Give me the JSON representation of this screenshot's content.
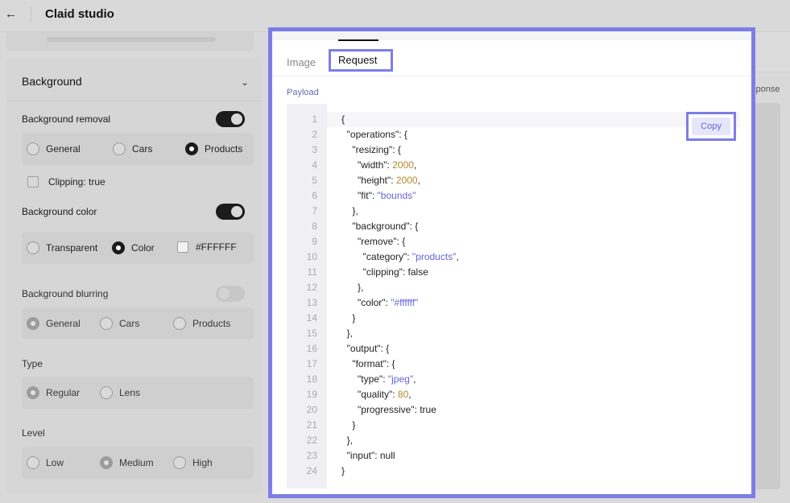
{
  "header": {
    "title": "Claid studio",
    "back_icon": "arrow-left-icon"
  },
  "left_panel": {
    "section_title": "Background",
    "background_removal": {
      "label": "Background removal",
      "toggle_on": true,
      "options": [
        "General",
        "Cars",
        "Products"
      ],
      "selected": "Products",
      "clipping_label": "Clipping: true"
    },
    "background_color": {
      "label": "Background color",
      "toggle_on": true,
      "options": [
        "Transparent",
        "Color"
      ],
      "selected": "Color",
      "hex_value": "#FFFFFF"
    },
    "background_blurring": {
      "label": "Background blurring",
      "toggle_on": false,
      "options": [
        "General",
        "Cars",
        "Products"
      ],
      "selected": "General"
    },
    "type": {
      "label": "Type",
      "options": [
        "Regular",
        "Lens"
      ],
      "selected": "Regular"
    },
    "level": {
      "label": "Level",
      "options": [
        "Low",
        "Medium",
        "High"
      ],
      "selected": "Medium"
    }
  },
  "main": {
    "tabs": [
      "Image",
      "Request"
    ],
    "active_tab": "Request",
    "payload_label": "Payload",
    "response_label": "Response",
    "copy_label": "Copy",
    "code_lines": [
      [
        {
          "t": "p",
          "v": "{"
        }
      ],
      [
        {
          "t": "p",
          "v": "  \"operations\": {"
        }
      ],
      [
        {
          "t": "p",
          "v": "    \"resizing\": {"
        }
      ],
      [
        {
          "t": "p",
          "v": "      \"width\": "
        },
        {
          "t": "n",
          "v": "2000"
        },
        {
          "t": "p",
          "v": ","
        }
      ],
      [
        {
          "t": "p",
          "v": "      \"height\": "
        },
        {
          "t": "n",
          "v": "2000"
        },
        {
          "t": "p",
          "v": ","
        }
      ],
      [
        {
          "t": "p",
          "v": "      \"fit\": "
        },
        {
          "t": "s",
          "v": "\"bounds\""
        }
      ],
      [
        {
          "t": "p",
          "v": "    },"
        }
      ],
      [
        {
          "t": "p",
          "v": "    \"background\": {"
        }
      ],
      [
        {
          "t": "p",
          "v": "      \"remove\": {"
        }
      ],
      [
        {
          "t": "p",
          "v": "        \"category\": "
        },
        {
          "t": "s",
          "v": "\"products\""
        },
        {
          "t": "p",
          "v": ","
        }
      ],
      [
        {
          "t": "p",
          "v": "        \"clipping\": false"
        }
      ],
      [
        {
          "t": "p",
          "v": "      },"
        }
      ],
      [
        {
          "t": "p",
          "v": "      \"color\": "
        },
        {
          "t": "s",
          "v": "\"#ffffff\""
        }
      ],
      [
        {
          "t": "p",
          "v": "    }"
        }
      ],
      [
        {
          "t": "p",
          "v": "  },"
        }
      ],
      [
        {
          "t": "p",
          "v": "  \"output\": {"
        }
      ],
      [
        {
          "t": "p",
          "v": "    \"format\": {"
        }
      ],
      [
        {
          "t": "p",
          "v": "      \"type\": "
        },
        {
          "t": "s",
          "v": "\"jpeg\""
        },
        {
          "t": "p",
          "v": ","
        }
      ],
      [
        {
          "t": "p",
          "v": "      \"quality\": "
        },
        {
          "t": "n",
          "v": "80"
        },
        {
          "t": "p",
          "v": ","
        }
      ],
      [
        {
          "t": "p",
          "v": "      \"progressive\": true"
        }
      ],
      [
        {
          "t": "p",
          "v": "    }"
        }
      ],
      [
        {
          "t": "p",
          "v": "  },"
        }
      ],
      [
        {
          "t": "p",
          "v": "  \"input\": null"
        }
      ],
      [
        {
          "t": "p",
          "v": "}"
        }
      ]
    ],
    "line_numbers": [
      "1",
      "2",
      "3",
      "4",
      "5",
      "6",
      "7",
      "8",
      "9",
      "10",
      "11",
      "12",
      "13",
      "14",
      "15",
      "16",
      "17",
      "18",
      "19",
      "20",
      "21",
      "22",
      "23",
      "24"
    ]
  },
  "colors": {
    "highlight": "#7d7de8",
    "string": "#6464d8",
    "number": "#b08a2b"
  }
}
